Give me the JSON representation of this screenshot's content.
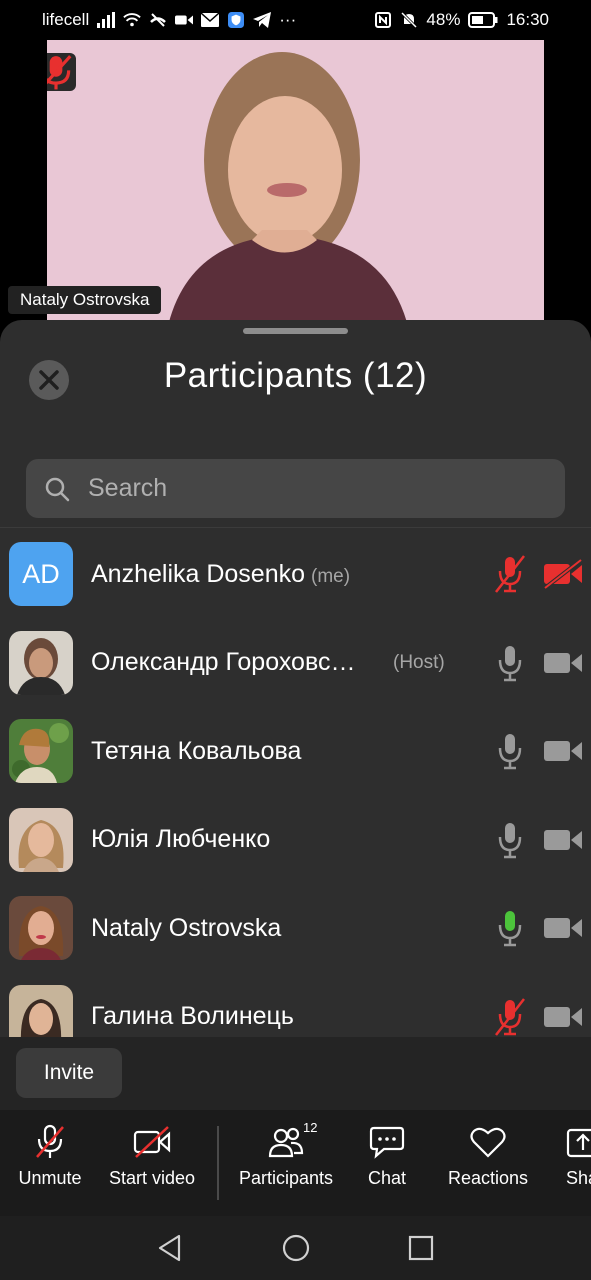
{
  "status_bar": {
    "carrier": "lifecell",
    "battery": "48%",
    "time": "16:30",
    "more": "···"
  },
  "video": {
    "speaker_name": "Nataly Ostrovska",
    "speaker_muted": true
  },
  "participants_sheet": {
    "title": "Participants (12)",
    "search_placeholder": "Search",
    "participants": [
      {
        "name": "Anzhelika Dosenko",
        "tag": "(me)",
        "initials": "AD",
        "mic": "muted",
        "camera": "off"
      },
      {
        "name": "Олександр Гороховс…",
        "tag": "(Host)",
        "mic": "off",
        "camera": "on"
      },
      {
        "name": "Тетяна Ковальова",
        "tag": "",
        "mic": "off",
        "camera": "on"
      },
      {
        "name": "Юлія Любченко",
        "tag": "",
        "mic": "off",
        "camera": "on"
      },
      {
        "name": "Nataly Ostrovska",
        "tag": "",
        "mic": "speaking",
        "camera": "on"
      },
      {
        "name": "Галина Волинець",
        "tag": "",
        "mic": "muted",
        "camera": "on"
      }
    ],
    "invite_label": "Invite"
  },
  "toolbar": {
    "unmute_label": "Unmute",
    "start_video_label": "Start video",
    "participants_label": "Participants",
    "participants_count": "12",
    "chat_label": "Chat",
    "reactions_label": "Reactions",
    "share_label": "Sha"
  },
  "colors": {
    "muted_red": "#e8302f",
    "speaking_green": "#4cc33b",
    "avatar_blue": "#4ea3f0",
    "sheet_bg": "#2e2e2e"
  },
  "icons": {
    "status": [
      "signal-icon",
      "wifi-icon",
      "no-call-icon",
      "video-call-icon",
      "mail-icon",
      "vpn-shield-icon",
      "telegram-icon",
      "nfc-icon",
      "silent-bell-icon",
      "battery-icon"
    ],
    "nav": [
      "back-icon",
      "home-icon",
      "recents-icon"
    ]
  }
}
